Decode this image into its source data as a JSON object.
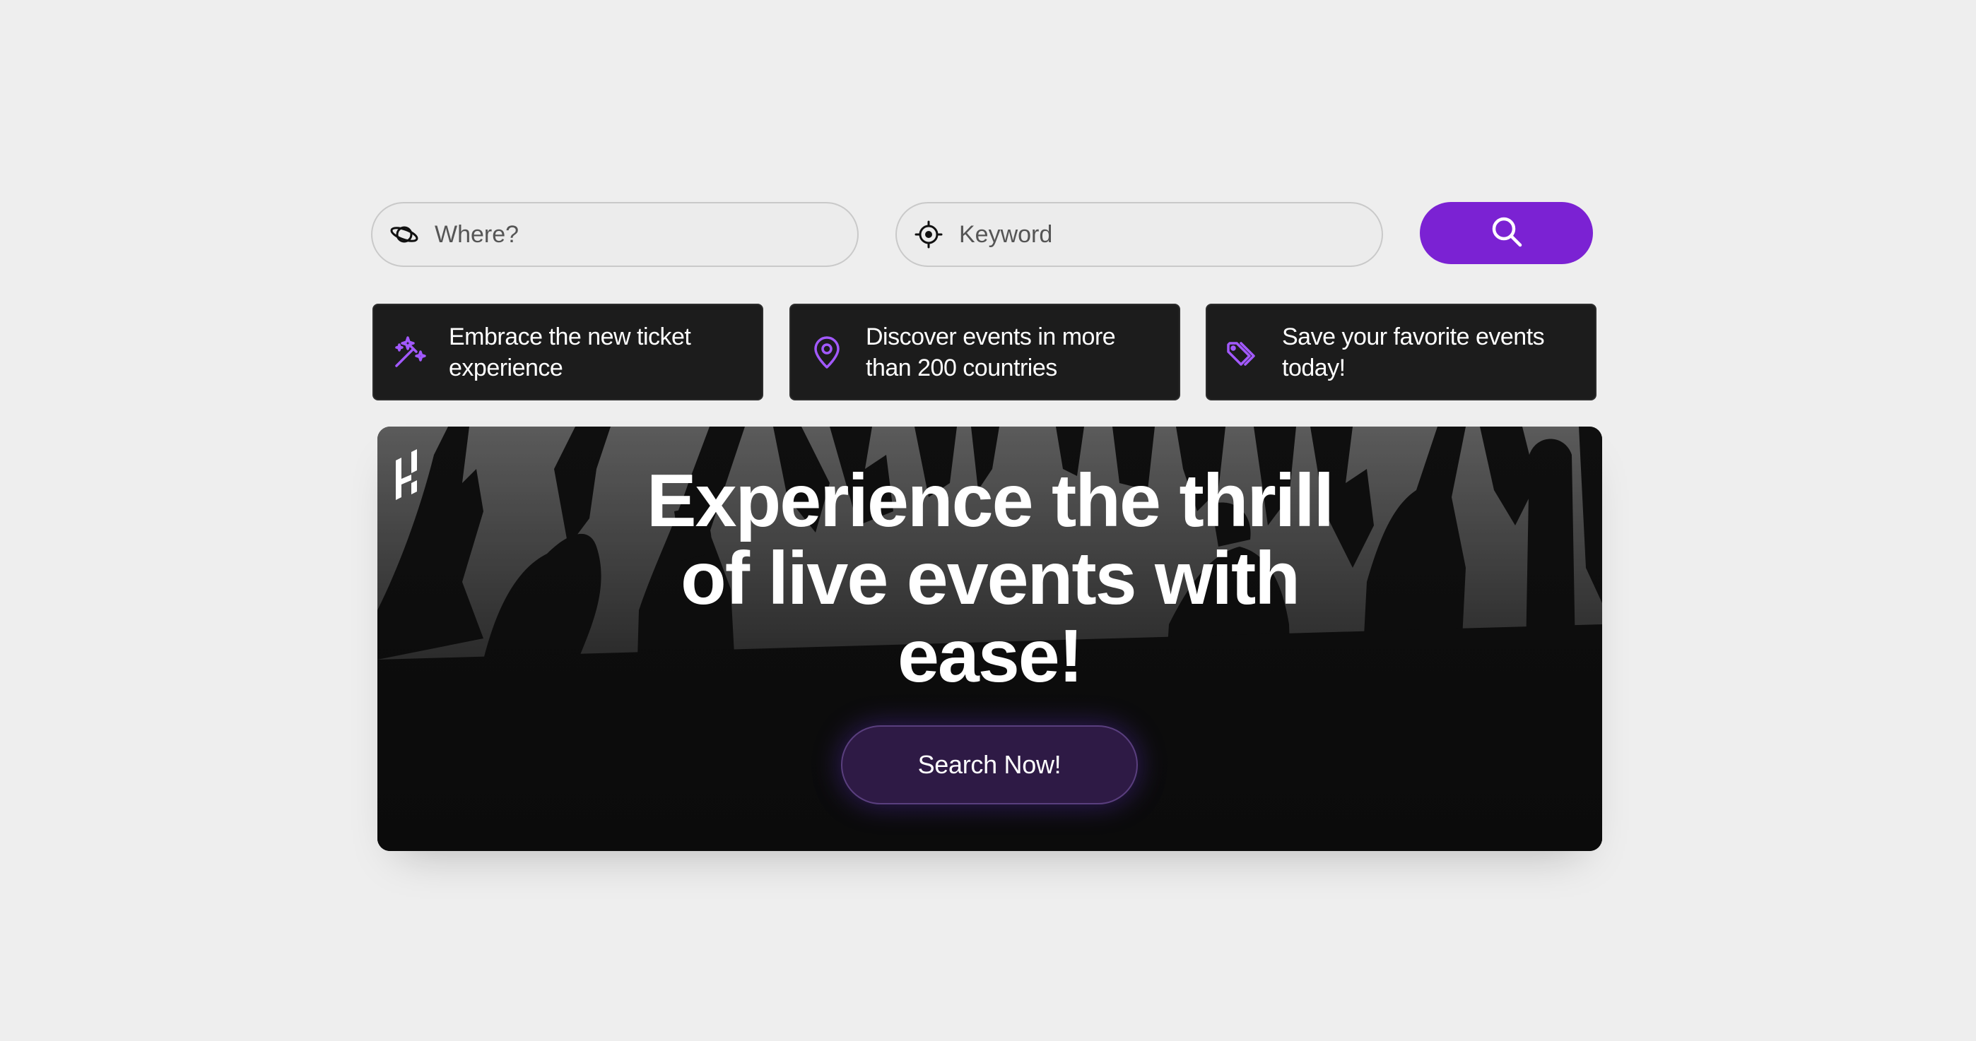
{
  "search": {
    "where_placeholder": "Where?",
    "where_icon": "planet-icon",
    "keyword_placeholder": "Keyword",
    "keyword_icon": "crosshair-icon",
    "button_icon": "search-icon",
    "button_color": "#7b22d3"
  },
  "features": [
    {
      "icon": "magic-wand-icon",
      "text": "Embrace the new ticket experience"
    },
    {
      "icon": "location-pin-icon",
      "text": "Discover events in more than 200 countries"
    },
    {
      "icon": "tags-icon",
      "text": "Save your favorite events today!"
    }
  ],
  "hero": {
    "headline_line1": "Experience the thrill",
    "headline_line2": "of live events with",
    "headline_line3": "ease!",
    "cta_label": "Search Now!",
    "logo_icon": "brand-logo-icon",
    "accent_color": "#a259ff"
  }
}
